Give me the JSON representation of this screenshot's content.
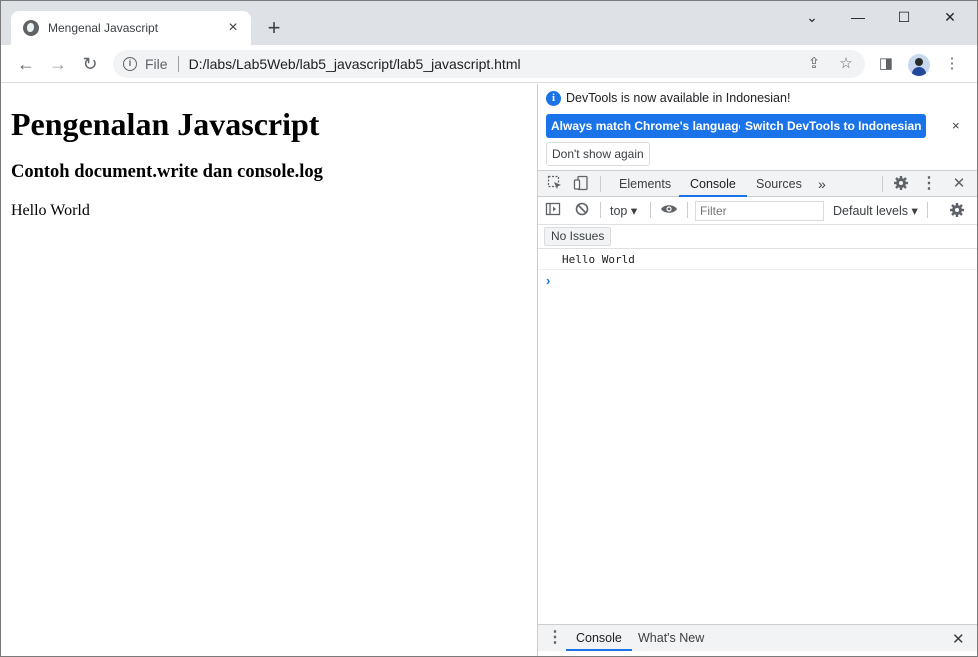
{
  "browser": {
    "tab_title": "Mengenal Javascript",
    "tab_close": "×",
    "new_tab": "+",
    "window_controls": {
      "minimize": "—",
      "maximize": "☐",
      "close": "✕",
      "tab_search": "⌄"
    },
    "toolbar": {
      "back": "←",
      "forward": "→",
      "reload": "↻",
      "scheme_label": "File",
      "url": "D:/labs/Lab5Web/lab5_javascript/lab5_javascript.html",
      "share": "⇪",
      "bookmark": "☆",
      "side_panel": "◨",
      "menu": "⋮"
    }
  },
  "page": {
    "heading": "Pengenalan Javascript",
    "subheading": "Contoh document.write dan console.log",
    "output": "Hello World"
  },
  "devtools": {
    "infobar": {
      "message": "DevTools is now available in Indonesian!",
      "btn_match": "Always match Chrome's language",
      "btn_switch": "Switch DevTools to Indonesian",
      "btn_dismiss": "Don't show again",
      "close": "×"
    },
    "tabs": [
      "Elements",
      "Console",
      "Sources"
    ],
    "more_tabs": "»",
    "console_toolbar": {
      "context": "top ▾",
      "filter_placeholder": "Filter",
      "levels": "Default levels ▾"
    },
    "issues": "No Issues",
    "log": "Hello World",
    "prompt": "›",
    "drawer": {
      "tabs": [
        "Console",
        "What's New"
      ],
      "close": "✕"
    }
  }
}
